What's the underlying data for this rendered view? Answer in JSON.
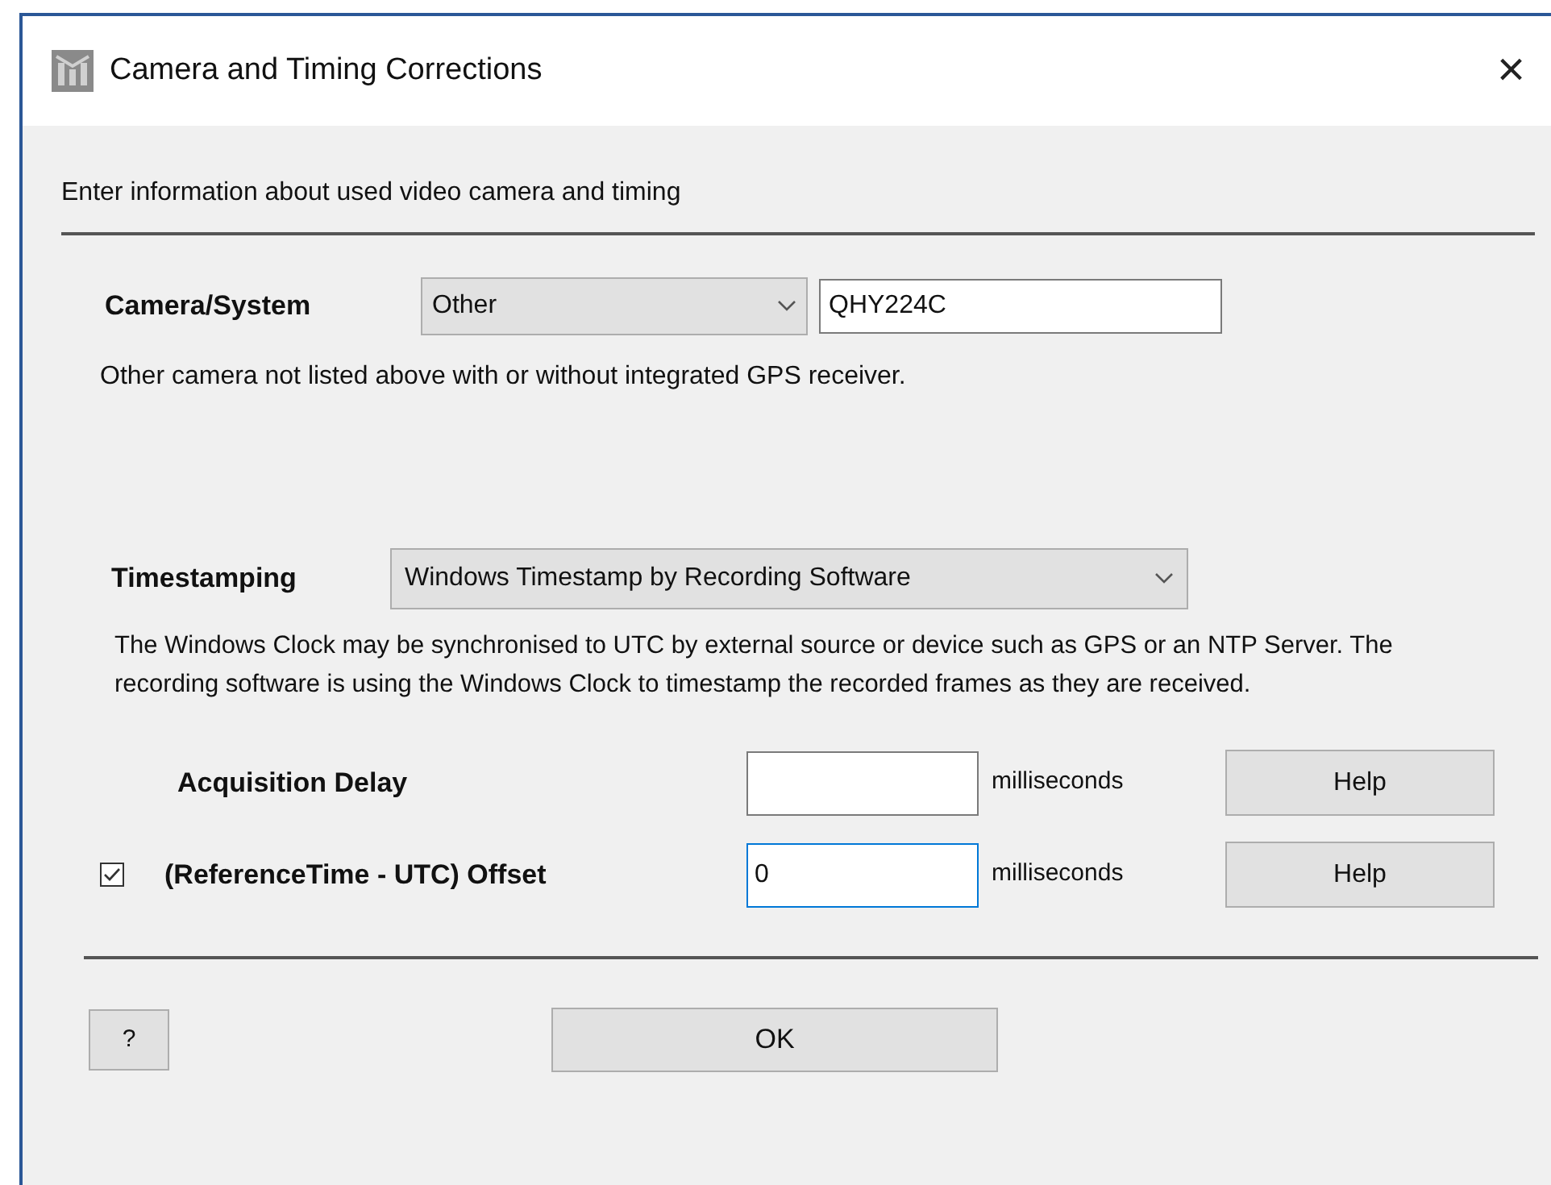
{
  "window": {
    "title": "Camera and Timing Corrections",
    "close": "×"
  },
  "intro": "Enter information about used video camera and timing",
  "camera": {
    "label": "Camera/System",
    "dropdown": "Other",
    "model": "QHY224C",
    "description": "Other camera not listed above with or without integrated GPS receiver."
  },
  "timestamping": {
    "label": "Timestamping",
    "dropdown": "Windows Timestamp by Recording Software",
    "description": "The Windows Clock may be synchronised to UTC by external source or device such as GPS or an NTP Server. The recording software is using the Windows Clock to timestamp the recorded frames as they are received."
  },
  "rows": [
    {
      "label": "Acquisition Delay",
      "value": "",
      "focused": false,
      "unit": "milliseconds",
      "button": "Help"
    },
    {
      "label": "(ReferenceTime - UTC) Offset",
      "checked": true,
      "value": "0",
      "focused": true,
      "unit": "milliseconds",
      "button": "Help"
    }
  ],
  "buttons": {
    "help": "?",
    "ok": "OK"
  }
}
